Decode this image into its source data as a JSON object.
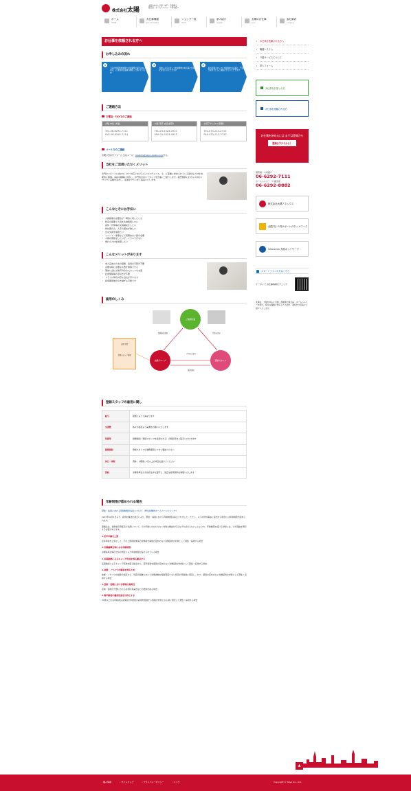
{
  "header": {
    "company_prefix": "株式会社",
    "company_name": "太陽",
    "sub_lines": [
      "大阪市中心に京都・神戸・首都圏で",
      "販売員・ホームヘルパー・人材を紹介"
    ]
  },
  "gnav": [
    {
      "label": "ホーム",
      "en": "HOME"
    },
    {
      "label": "お仕事情報",
      "en": "job information"
    },
    {
      "label": "ショップ一覧",
      "en": "SHOP"
    },
    {
      "label": "求人紹介",
      "en": "register"
    },
    {
      "label": "太陽のお仕事",
      "en": "work"
    },
    {
      "label": "会社案内",
      "en": "company"
    }
  ],
  "main": {
    "page_title": "お仕事を依頼される方へ",
    "flow_title": "お申し込みの流れ",
    "flow_steps": [
      {
        "num": "1",
        "text": "下記の営業所を最寄りの営業所と取引のないお店、(ご希望の店舗を)参照して頂いている方"
      },
      {
        "num": "2",
        "text": "当社によるスタッフを最寄地のお店舗と日程をお合いいただきます"
      },
      {
        "num": "3",
        "text": "担当営業スタッフに最寄地のお店舗と、予定が決まったらご連絡させていただきます"
      }
    ],
    "contact_title": "ご連絡方法",
    "tel_sub": "お電話・FAXでのご連絡",
    "offices": [
      {
        "name": "大阪 本社 (大阪)",
        "tel": "TEL.06-6292-7111",
        "fax": "FAX.06-6292-7114"
      },
      {
        "name": "大阪 東京 支店(関東)",
        "tel": "TEL.03-5323-0910",
        "fax": "FAX.03-5323-0911"
      },
      {
        "name": "大阪アネックス(京都)",
        "tel": "TEL.075-213-2710",
        "fax": "FAX.075-213-2730"
      }
    ],
    "mail_sub": "メールでのご連絡",
    "mail_text": "お問い合わせフォーム 又はメール：",
    "mail_addr": "mailinfo@taiyo-osaka.co.jp",
    "mail_suffix": "から。",
    "merit_title": "当社をご活用いただくメリット",
    "merit_text": "専門のスピードに合わせ、対一対応におけるビジネスチャンス。今、ご事業に求められている適切な人材を効果的に確保。多彩な職種に対応し、専門性の高いスタッフを迅速にご紹介します。販売業界における人材のノウハウと実績を活かし、最適なプランをご提案いたします。",
    "when_title": "こんなときにお手伝い",
    "when_items": [
      "人員確保の必要性が一時的に増したとき",
      "新店の開業で人員を急遽確保したい",
      "産休・育休等の欠員補充をしたい",
      "繁忙期のみ、人手の補充が欲しい",
      "急な欠員を埋めたい",
      "イベント・催事などで短期的な人員が必要",
      "人員の募集をしたいが、ノウハウがない",
      "慣れた人材を確保したい"
    ],
    "benefit_title": "こんなメリットがあります",
    "benefit_items": [
      "求人広告のための経費、採用の手間が不要",
      "必要な時に必要な人数を確保できる",
      "事前に当社で教育済みのスタッフを派遣",
      "社会保険等の手続きが不要",
      "トラブル時の対応も当社が行います",
      "雇用期間後の引き継ぎも可能です"
    ],
    "system_title": "雇用のしくみ",
    "diagram": {
      "client": "ご依頼企業",
      "taiyo": "太陽グループ",
      "staff": "登録スタッフ",
      "label_contract": "業務委託契約",
      "label_dispatch": "人材のご紹介",
      "label_work": "仕事の指示",
      "label_employ": "雇用契約",
      "label_left": "太陽 営業",
      "label_left2": "登録スタッフ管理"
    },
    "conditions_title": "登録スタッフの雇用に関し",
    "conditions": [
      {
        "k": "給与",
        "v": "勤務によって異なります"
      },
      {
        "k": "交通費",
        "v": "各々の会社より実費をお願いいたします"
      },
      {
        "k": "時間帯",
        "v": "勤務時間（登録スタッフを雇用される）の時間帯をご提示いただきます"
      },
      {
        "k": "勤務期間",
        "v": "登録スタッフの勤務期間につきご相談ください"
      },
      {
        "k": "休日・休暇",
        "v": "週休、1週間に1日以上の休日を設けてください"
      },
      {
        "k": "契約",
        "v": "労働基準法その他の法令を遵守し、適正な雇用契約を締結いたします"
      }
    ],
    "article_title": "年齢制限が認められる場合",
    "article_link": "募集・採用における年齢制限の禁止について（厚生労働省ホームページにリンク）",
    "article_paragraphs": [
      "2007年10月1日より、雇用対策法の改正により、募集・採用における年齢制限は禁止されました。ただし、以下の例外事由に該当する場合には年齢制限が認められます。",
      "事業主は、労働者の募集及び採用について、その年齢にかかわりなく均等な機会を与えなければならないこととされ、年齢制限を設ける場合には、その理由を明示する必要があります。"
    ],
    "article_sections": [
      {
        "h": "1.定年年齢を上限",
        "p": "定年年齢を上限として、その上限年齢未満の労働者を期間の定めのない労働契約の対象として募集・採用する場合"
      },
      {
        "h": "2.労働基準法等による年齢制限",
        "p": "労働基準法等の法令の規定により年齢制限が設けられている場合"
      },
      {
        "h": "3.長期勤続によるキャリア形成を図る観点から",
        "p": "長期勤続によるキャリア形成を図る観点から、若年者等を期間の定めのない労働契約の対象として募集・採用する場合"
      },
      {
        "h": "4.技能・ノウハウの継承を図るため",
        "p": "技能・ノウハウの継承の観点から、特定の職種において労働者数が相当程度少ない特定の年齢層に限定し、かつ、期間の定めのない労働契約の対象として募集・採用する場合"
      },
      {
        "h": "5.芸術・芸能における表現の真実性",
        "p": "芸術・芸能の分野における表現の真実性などの要請がある場合"
      },
      {
        "h": "6.高年齢者の雇用促進を目的とする",
        "p": "60歳以上の高年齢者又は特定の年齢層の雇用を促進する施策の対象となる者に限定して募集・採用する場合"
      }
    ]
  },
  "side": {
    "menu": [
      {
        "label": "お仕事を依頼される方へ",
        "active": true
      },
      {
        "label": "職種システム",
        "active": false
      },
      {
        "label": "介護サービスについて",
        "active": false
      },
      {
        "label": "求人フォーム",
        "active": false
      }
    ],
    "btn_register": "お仕事をお探しの方",
    "btn_request": "お仕事を依頼される方",
    "red_box_text": "お仕事を始めるには まずは登録から",
    "red_box_btn": "登録はコチラから！",
    "tel1_label": "販売員・人材紹介",
    "tel1": "06-6292-7111",
    "tel2_label": "ホームヘルパー・介護支援",
    "tel2": "06-6292-8882",
    "banner1": "株式会社太陽アネックス",
    "banner2": "全国7社 人材サポートのネットワーク",
    "banner3": "Infocomm 大阪ネットワーク",
    "sp_title": "スマートフォンの方はこちら",
    "sp_text": "ケータイで お仕事情報をチェック",
    "side_text": "太陽は、大阪を中心に京都・首都圏で販売員、ホームヘルパーを紹介。様々な職種に対応した人材を、適切かつ迅速にご紹介いたします。"
  },
  "footer": {
    "links": [
      "個人情報",
      "サイトマップ",
      "プライバシーポリシー",
      "リンク"
    ],
    "copyright": "Copyright © Taiyo Co., Ltd."
  },
  "colors": {
    "brand": "#c8102e",
    "flow": "#1a78c2",
    "green": "#3aa63a",
    "link": "#1a55a0"
  }
}
